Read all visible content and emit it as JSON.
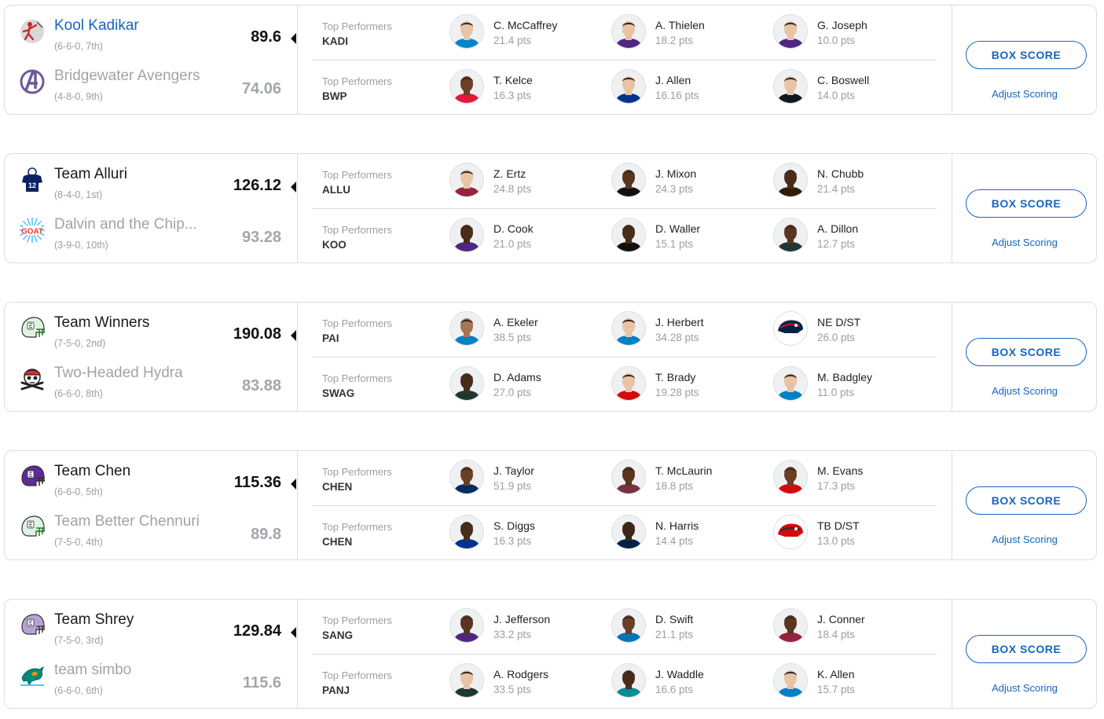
{
  "section_label": "Top Performers",
  "box_score_label": "BOX SCORE",
  "adjust_scoring_label": "Adjust Scoring",
  "colors": {
    "link_blue": "#1565c0",
    "border": "#dcdddf",
    "muted_text": "#9a9ea4"
  },
  "matchups": [
    {
      "team1": {
        "name": "Kool Kadikar",
        "record": "(6-6-0, 7th)",
        "score": "89.6",
        "abbr": "KADI",
        "logo": "ninja-logo-icon",
        "is_link": true
      },
      "team2": {
        "name": "Bridgewater Avengers",
        "record": "(4-8-0, 9th)",
        "score": "74.06",
        "abbr": "BWP",
        "logo": "avengers-logo-icon"
      },
      "team1_players": [
        {
          "name": "C. McCaffrey",
          "pts": "21.4 pts",
          "jersey": "#0085ca",
          "skin": "#e8c3a5"
        },
        {
          "name": "A. Thielen",
          "pts": "18.2 pts",
          "jersey": "#4f2683",
          "skin": "#e8c3a5"
        },
        {
          "name": "G. Joseph",
          "pts": "10.0 pts",
          "jersey": "#4f2683",
          "skin": "#e8c3a5"
        }
      ],
      "team2_players": [
        {
          "name": "T. Kelce",
          "pts": "16.3 pts",
          "jersey": "#e31837",
          "skin": "#6b3f26"
        },
        {
          "name": "J. Allen",
          "pts": "16.16 pts",
          "jersey": "#00338d",
          "skin": "#e8c3a5"
        },
        {
          "name": "C. Boswell",
          "pts": "14.0 pts",
          "jersey": "#101820",
          "skin": "#e8c3a5"
        }
      ]
    },
    {
      "team1": {
        "name": "Team Alluri",
        "record": "(8-4-0, 1st)",
        "score": "126.12",
        "abbr": "ALLU",
        "logo": "jersey-12-icon"
      },
      "team2": {
        "name": "Dalvin and the Chip...",
        "record": "(3-9-0, 10th)",
        "score": "93.28",
        "abbr": "KOO",
        "logo": "goat-logo-icon"
      },
      "team1_players": [
        {
          "name": "Z. Ertz",
          "pts": "24.8 pts",
          "jersey": "#97233f",
          "skin": "#e8c3a5"
        },
        {
          "name": "J. Mixon",
          "pts": "24.3 pts",
          "jersey": "#111111",
          "skin": "#5a3520"
        },
        {
          "name": "N. Chubb",
          "pts": "21.4 pts",
          "jersey": "#311d00",
          "skin": "#4a2c1a"
        }
      ],
      "team2_players": [
        {
          "name": "D. Cook",
          "pts": "21.0 pts",
          "jersey": "#4f2683",
          "skin": "#4a2c1a"
        },
        {
          "name": "D. Waller",
          "pts": "15.1 pts",
          "jersey": "#111111",
          "skin": "#4a2c1a"
        },
        {
          "name": "A. Dillon",
          "pts": "12.7 pts",
          "jersey": "#203731",
          "skin": "#5a3520"
        }
      ]
    },
    {
      "team1": {
        "name": "Team Winners",
        "record": "(7-5-0, 2nd)",
        "score": "190.08",
        "abbr": "PAI",
        "logo": "green-helmet-icon"
      },
      "team2": {
        "name": "Two-Headed Hydra",
        "record": "(6-6-0, 8th)",
        "score": "83.88",
        "abbr": "SWAG",
        "logo": "skull-logo-icon"
      },
      "team1_players": [
        {
          "name": "A. Ekeler",
          "pts": "38.5 pts",
          "jersey": "#0080c6",
          "skin": "#a87452"
        },
        {
          "name": "J. Herbert",
          "pts": "34.28 pts",
          "jersey": "#0080c6",
          "skin": "#e8c3a5"
        },
        {
          "name": "NE D/ST",
          "pts": "26.0 pts",
          "jersey": "#002244",
          "skin": "#c60c30"
        }
      ],
      "team2_players": [
        {
          "name": "D. Adams",
          "pts": "27.0 pts",
          "jersey": "#203731",
          "skin": "#4a2c1a"
        },
        {
          "name": "T. Brady",
          "pts": "19.28 pts",
          "jersey": "#d50a0a",
          "skin": "#e8c3a5"
        },
        {
          "name": "M. Badgley",
          "pts": "11.0 pts",
          "jersey": "#0080c6",
          "skin": "#e8c3a5"
        }
      ]
    },
    {
      "team1": {
        "name": "Team Chen",
        "record": "(6-6-0, 5th)",
        "score": "115.36",
        "abbr": "CHEN",
        "logo": "purple-helmet-icon"
      },
      "team2": {
        "name": "Team Better Chennuri",
        "record": "(7-5-0, 4th)",
        "score": "89.8",
        "abbr": "CHEN",
        "logo": "green-helmet-icon"
      },
      "team1_players": [
        {
          "name": "J. Taylor",
          "pts": "51.9 pts",
          "jersey": "#002c5f",
          "skin": "#6b3f26"
        },
        {
          "name": "T. McLaurin",
          "pts": "18.8 pts",
          "jersey": "#773141",
          "skin": "#5a3520"
        },
        {
          "name": "M. Evans",
          "pts": "17.3 pts",
          "jersey": "#d50a0a",
          "skin": "#6b3f26"
        }
      ],
      "team2_players": [
        {
          "name": "S. Diggs",
          "pts": "16.3 pts",
          "jersey": "#00338d",
          "skin": "#4a2c1a"
        },
        {
          "name": "N. Harris",
          "pts": "14.4 pts",
          "jersey": "#002244",
          "skin": "#3d2416"
        },
        {
          "name": "TB D/ST",
          "pts": "13.0 pts",
          "jersey": "#d50a0a",
          "skin": "#34302b"
        }
      ]
    },
    {
      "team1": {
        "name": "Team Shrey",
        "record": "(7-5-0, 3rd)",
        "score": "129.84",
        "abbr": "SANG",
        "logo": "lavender-helmet-icon"
      },
      "team2": {
        "name": "team simbo",
        "record": "(6-6-0, 6th)",
        "score": "115.6",
        "abbr": "PANJ",
        "logo": "dolphin-logo-icon"
      },
      "team1_players": [
        {
          "name": "J. Jefferson",
          "pts": "33.2 pts",
          "jersey": "#4f2683",
          "skin": "#5a3520"
        },
        {
          "name": "D. Swift",
          "pts": "21.1 pts",
          "jersey": "#0076b6",
          "skin": "#6b3f26"
        },
        {
          "name": "J. Conner",
          "pts": "18.4 pts",
          "jersey": "#97233f",
          "skin": "#5a3520"
        }
      ],
      "team2_players": [
        {
          "name": "A. Rodgers",
          "pts": "33.5 pts",
          "jersey": "#203731",
          "skin": "#e8c3a5"
        },
        {
          "name": "J. Waddle",
          "pts": "16.6 pts",
          "jersey": "#008e97",
          "skin": "#4a2c1a"
        },
        {
          "name": "K. Allen",
          "pts": "15.7 pts",
          "jersey": "#0080c6",
          "skin": "#e8c3a5"
        }
      ]
    }
  ]
}
